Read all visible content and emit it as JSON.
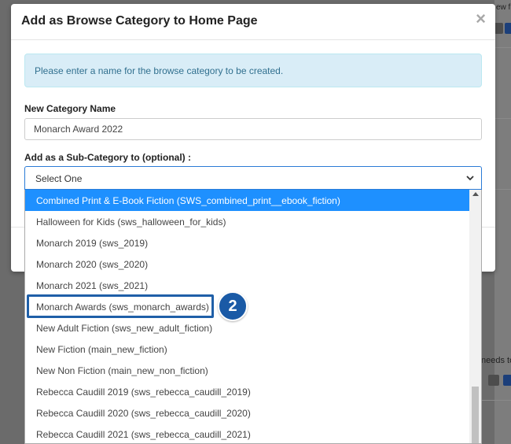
{
  "background": {
    "text_top": "ew fr",
    "text_mid": "needs to"
  },
  "modal": {
    "title": "Add as Browse Category to Home Page",
    "close_label": "×",
    "info_text": "Please enter a name for the browse category to be created.",
    "name_label": "New Category Name",
    "name_value": "Monarch Award 2022",
    "subcat_label": "Add as a Sub-Category to (optional) :",
    "select_value": "Select One"
  },
  "dropdown": {
    "options": [
      "Combined Print & E-Book Fiction (SWS_combined_print__ebook_fiction)",
      "Halloween for Kids (sws_halloween_for_kids)",
      "Monarch 2019 (sws_2019)",
      "Monarch 2020 (sws_2020)",
      "Monarch 2021 (sws_2021)",
      "Monarch Awards (sws_monarch_awards)",
      "New Adult Fiction (sws_new_adult_fiction)",
      "New Fiction (main_new_fiction)",
      "New Non Fiction (main_new_non_fiction)",
      "Rebecca Caudill 2019 (sws_rebecca_caudill_2019)",
      "Rebecca Caudill 2020 (sws_rebecca_caudill_2020)",
      "Rebecca Caudill 2021 (sws_rebecca_caudill_2021)"
    ],
    "highlighted_index": 0
  },
  "annotation": {
    "step_number": "2"
  },
  "colors": {
    "accent": "#1e90ff",
    "annotation": "#1a5aa6",
    "info_bg": "#d9edf7"
  }
}
